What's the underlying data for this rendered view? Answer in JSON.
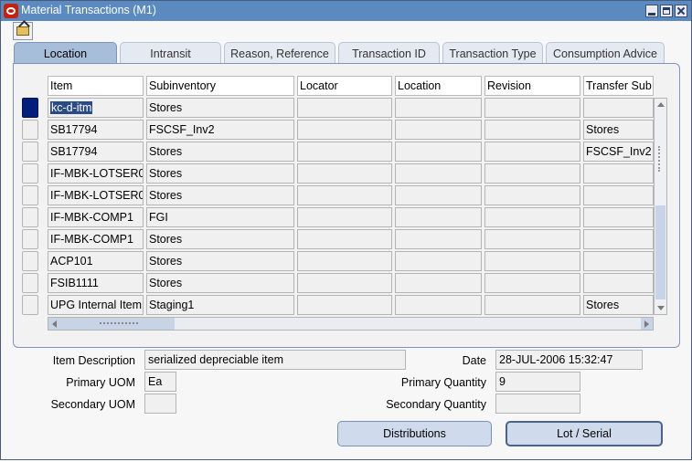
{
  "window": {
    "title": "Material Transactions (M1)"
  },
  "tabs": [
    "Location",
    "Intransit",
    "Reason, Reference",
    "Transaction ID",
    "Transaction Type",
    "Consumption Advice"
  ],
  "table": {
    "columns": [
      "Item",
      "Subinventory",
      "Locator",
      "Location",
      "Revision",
      "Transfer Sub"
    ],
    "rows": [
      [
        "kc-d-itm",
        "Stores",
        "",
        "",
        "",
        ""
      ],
      [
        "SB17794",
        "FSCSF_Inv2",
        "",
        "",
        "",
        "Stores"
      ],
      [
        "SB17794",
        "Stores",
        "",
        "",
        "",
        "FSCSF_Inv2"
      ],
      [
        "IF-MBK-LOTSER0",
        "Stores",
        "",
        "",
        "",
        ""
      ],
      [
        "IF-MBK-LOTSER0",
        "Stores",
        "",
        "",
        "",
        ""
      ],
      [
        "IF-MBK-COMP1",
        "FGI",
        "",
        "",
        "",
        ""
      ],
      [
        "IF-MBK-COMP1",
        "Stores",
        "",
        "",
        "",
        ""
      ],
      [
        "ACP101",
        "Stores",
        "",
        "",
        "",
        ""
      ],
      [
        "FSIB1111",
        "Stores",
        "",
        "",
        "",
        ""
      ],
      [
        "UPG Internal Item",
        "Staging1",
        "",
        "",
        "",
        "Stores"
      ]
    ]
  },
  "details": {
    "item_description_label": "Item Description",
    "item_description": "serialized depreciable item",
    "date_label": "Date",
    "date": "28-JUL-2006 15:32:47",
    "primary_uom_label": "Primary UOM",
    "primary_uom": "Ea",
    "primary_quantity_label": "Primary Quantity",
    "primary_quantity": "9",
    "secondary_uom_label": "Secondary UOM",
    "secondary_uom": "",
    "secondary_quantity_label": "Secondary Quantity",
    "secondary_quantity": ""
  },
  "buttons": {
    "distributions": "Distributions",
    "lot_serial": "Lot / Serial"
  },
  "icons": {
    "app": "oracle-logo-icon",
    "toolbar": "open-folder-icon"
  },
  "colors": {
    "titlebar": "#5b8ac0",
    "active_tab": "#a7bedb",
    "selection": "#2b4b86",
    "row_indicator": "#001f7a"
  }
}
